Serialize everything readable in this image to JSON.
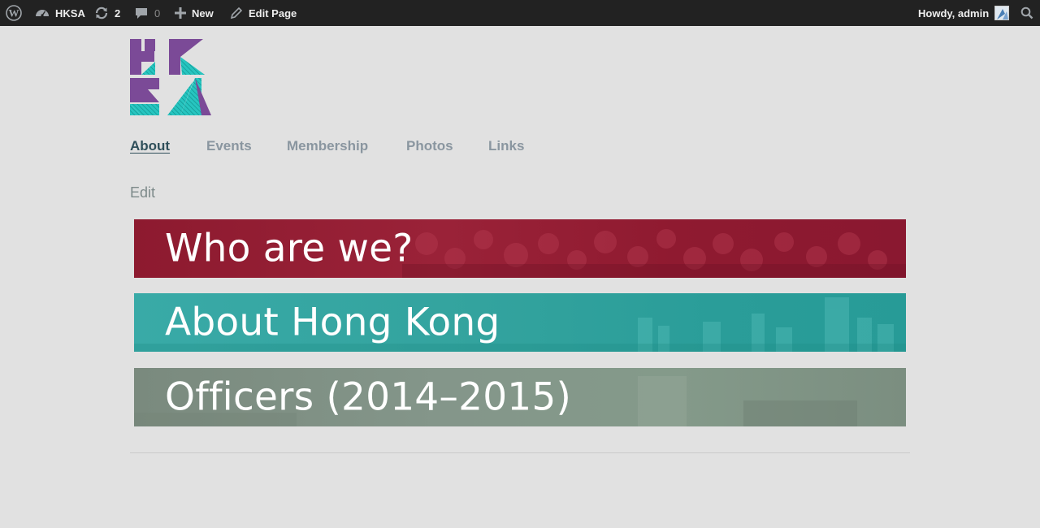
{
  "adminbar": {
    "site_name": "HKSA",
    "updates_count": "2",
    "comments_count": "0",
    "new_label": "New",
    "edit_page_label": "Edit Page",
    "howdy": "Howdy, admin"
  },
  "logo": {
    "alt": "HKSA",
    "colors": {
      "purple": "#7b4a97",
      "teal": "#27c5c0"
    }
  },
  "nav": {
    "items": [
      {
        "label": "About",
        "active": true
      },
      {
        "label": "Events",
        "active": false
      },
      {
        "label": "Membership",
        "active": false
      },
      {
        "label": "Photos",
        "active": false
      },
      {
        "label": "Links",
        "active": false
      }
    ]
  },
  "edit_label": "Edit",
  "banners": [
    {
      "label": "Who are we?",
      "color": "#8d1a2f"
    },
    {
      "label": "About Hong Kong",
      "color": "#33a39e"
    },
    {
      "label": "Officers (2014–2015)",
      "color": "#84968a"
    }
  ]
}
